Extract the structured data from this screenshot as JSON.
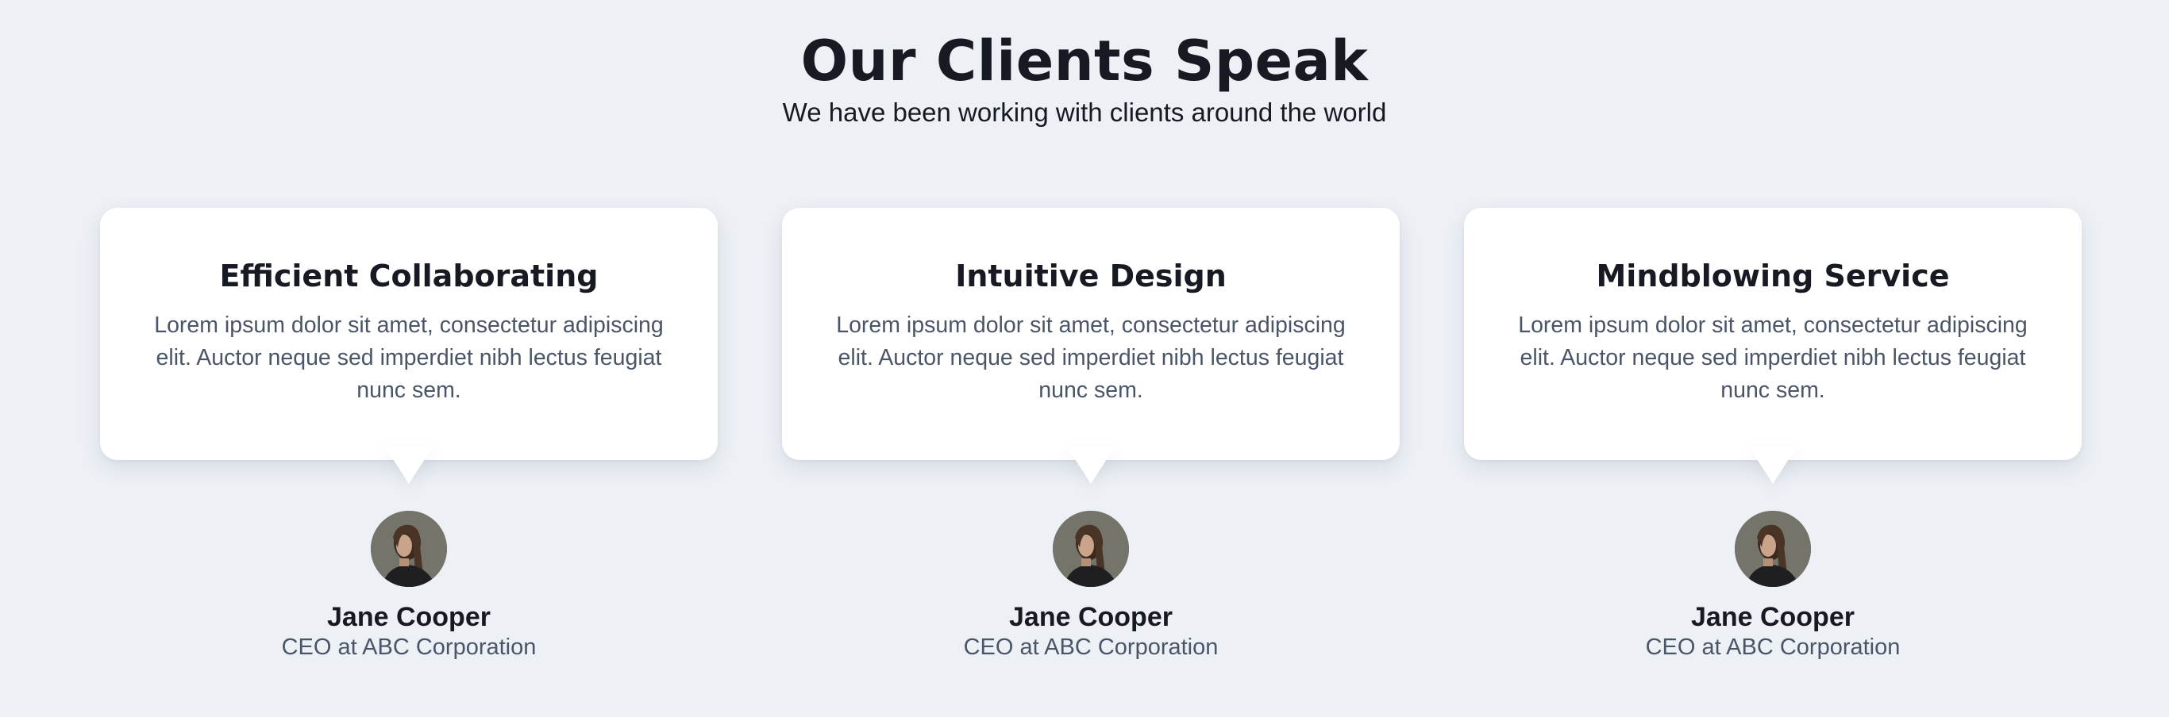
{
  "header": {
    "title": "Our Clients Speak",
    "subtitle": "We have been working with clients around the world"
  },
  "testimonials": [
    {
      "heading": "Efficient Collaborating",
      "quote": "Lorem ipsum dolor sit amet, consectetur adipiscing elit. Auctor neque sed imperdiet nibh lectus feugiat nunc sem.",
      "name": "Jane Cooper",
      "role": "CEO at ABC Corporation",
      "avatar_icon": "person-photo"
    },
    {
      "heading": "Intuitive Design",
      "quote": "Lorem ipsum dolor sit amet, consectetur adipiscing elit. Auctor neque sed imperdiet nibh lectus feugiat nunc sem.",
      "name": "Jane Cooper",
      "role": "CEO at ABC Corporation",
      "avatar_icon": "person-photo"
    },
    {
      "heading": "Mindblowing Service",
      "quote": "Lorem ipsum dolor sit amet, consectetur adipiscing elit. Auctor neque sed imperdiet nibh lectus feugiat nunc sem.",
      "name": "Jane Cooper",
      "role": "CEO at ABC Corporation",
      "avatar_icon": "person-photo"
    }
  ],
  "colors": {
    "background": "#edf1f6",
    "card": "#ffffff",
    "heading_text": "#171923",
    "body_text": "#4a5568"
  }
}
